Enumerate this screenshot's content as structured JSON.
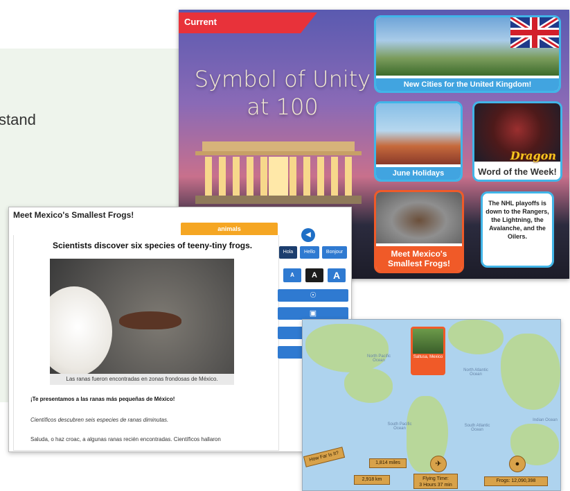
{
  "background": {
    "fragment_text": "stand"
  },
  "current": {
    "tag": "Current",
    "headline_line1": "Symbol of Unity",
    "headline_line2": "at 100",
    "tiles": {
      "uk": "New Cities for the United Kingdom!",
      "june": "June Holidays",
      "word_dragon": "Dragon",
      "word_of_week": "Word of the Week!",
      "frog_line1": "Meet Mexico's",
      "frog_line2": "Smallest Frogs!",
      "nhl": "The NHL playoffs is down to the Rangers, the Lightning, the Avalanche, and the Oilers."
    }
  },
  "article": {
    "window_title": "Meet Mexico's Smallest Frogs!",
    "category_tab": "animals",
    "headline": "Scientists discover six species of teeny-tiny frogs.",
    "caption": "Las ranas fueron encontradas en zonas frondosas de México.",
    "para1": "¡Te presentamos a las ranas más pequeñas de México!",
    "para2": "Científicos descubren seis especies de ranas diminutas.",
    "para3": "Saluda, o haz croac, a algunas ranas recién encontradas. Científicos hallaron",
    "tools": {
      "languages": [
        "Hola",
        "Hello",
        "Bonjour"
      ],
      "selected_language": "Hola",
      "sizes": [
        "A",
        "A",
        "A"
      ]
    }
  },
  "map": {
    "pin_place": "Saltusa, Mexico",
    "how_far": "How Far Is It?",
    "miles": "1,814 miles",
    "km": "2,918 km",
    "flying_time_label": "Flying Time:",
    "flying_time_value": "3 Hours 37 min",
    "frogs": "Frogs: 12,090,398",
    "ocean_labels": [
      "North Pacific Ocean",
      "North Atlantic Ocean",
      "South Pacific Ocean",
      "South Atlantic Ocean",
      "Indian Ocean"
    ]
  }
}
